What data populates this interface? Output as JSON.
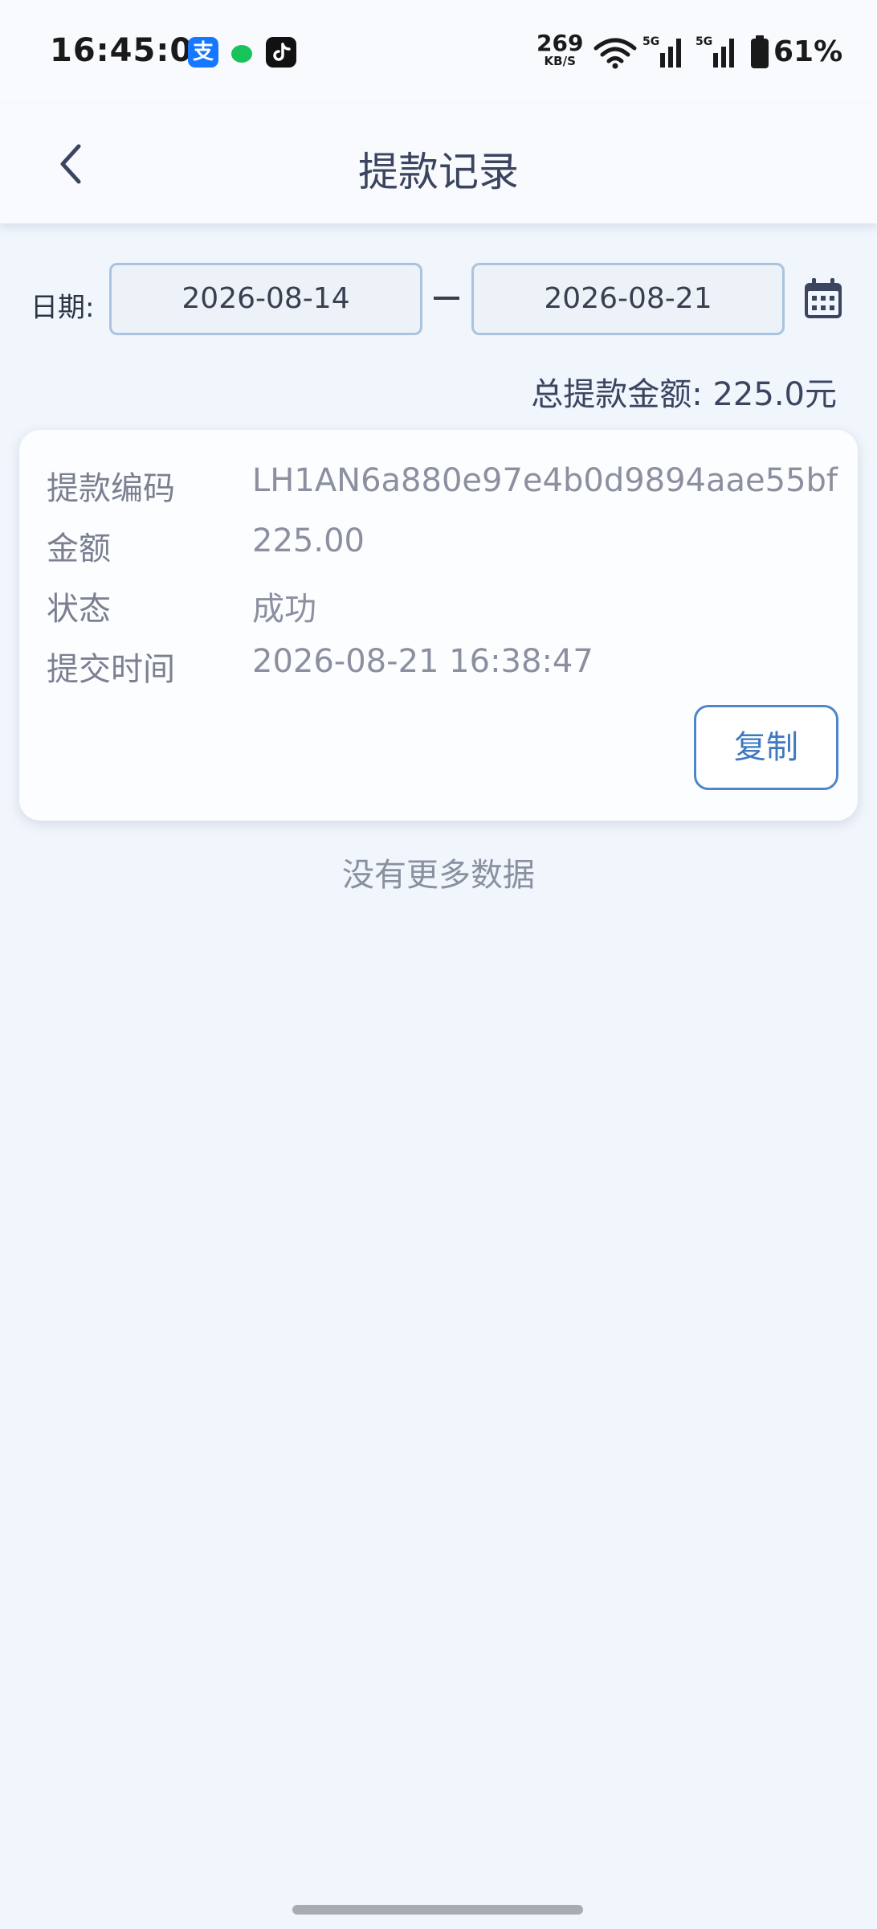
{
  "status_bar": {
    "time": "16:45:01",
    "alipay_glyph": "支",
    "net_speed": "269",
    "net_speed_unit": "KB/S",
    "battery": "61%"
  },
  "header": {
    "title": "提款记录"
  },
  "filter": {
    "date_label": "日期:",
    "start_date": "2026-08-14",
    "end_date": "2026-08-21"
  },
  "summary": {
    "total_text": "总提款金额: 225.0元"
  },
  "records": [
    {
      "code_label": "提款编码",
      "code_value": "LH1AN6a880e97e4b0d9894aae55bf",
      "amount_label": "金额",
      "amount_value": "225.00",
      "status_label": "状态",
      "status_value": "成功",
      "time_label": "提交时间",
      "time_value": "2026-08-21 16:38:47",
      "copy_label": "复制"
    }
  ],
  "footer": {
    "no_more_text": "没有更多数据"
  }
}
